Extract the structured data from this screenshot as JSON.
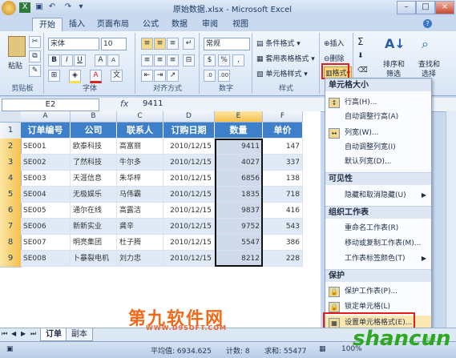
{
  "window": {
    "title": "原始数据.xlsx - Microsoft Excel"
  },
  "ribbon_tabs": [
    "开始",
    "插入",
    "页面布局",
    "公式",
    "数据",
    "审阅",
    "视图"
  ],
  "ribbon": {
    "clipboard": {
      "paste": "粘贴",
      "label": "剪贴板"
    },
    "font": {
      "name": "宋体",
      "size": "10",
      "label": "字体",
      "bold": "B",
      "italic": "I",
      "underline": "U",
      "grow": "A",
      "shrink": "A",
      "color": "A"
    },
    "alignment": {
      "label": "对齐方式"
    },
    "number": {
      "format": "常规",
      "label": "数字",
      "percent": "%",
      "comma": ",",
      "currency": "$"
    },
    "styles": {
      "conditional": "条件格式",
      "table": "套用表格格式",
      "cell": "单元格样式",
      "label": "样式"
    },
    "cells": {
      "insert": "插入",
      "delete": "删除",
      "format": "格式"
    },
    "editing": {
      "sum": "Σ",
      "sort": "排序和",
      "sort2": "筛选",
      "find": "查找和",
      "find2": "选择"
    }
  },
  "formula_bar": {
    "name_box": "E2",
    "fx": "fx",
    "value": "9411"
  },
  "columns": [
    "A",
    "B",
    "C",
    "D",
    "E",
    "F"
  ],
  "selected_column": "E",
  "rows": [
    "1",
    "2",
    "3",
    "4",
    "5",
    "6",
    "7",
    "8",
    "9"
  ],
  "table": {
    "headers": [
      "订单编号",
      "公司",
      "联系人",
      "订购日期",
      "数量",
      "单价"
    ],
    "data": [
      [
        "SE001",
        "欧泰科技",
        "高富丽",
        "2010/12/15",
        "9411",
        "147"
      ],
      [
        "SE002",
        "了然科技",
        "牛尔多",
        "2010/12/15",
        "4027",
        "337"
      ],
      [
        "SE003",
        "天涯信息",
        "朱华梓",
        "2010/12/15",
        "6856",
        "138"
      ],
      [
        "SE004",
        "无极娱乐",
        "马伟霸",
        "2010/12/15",
        "1835",
        "718"
      ],
      [
        "SE005",
        "通尔在线",
        "高露洁",
        "2010/12/15",
        "9837",
        "416"
      ],
      [
        "SE006",
        "新新实业",
        "龚辛",
        "2010/12/15",
        "9752",
        "543"
      ],
      [
        "SE007",
        "明亮集团",
        "杜子腾",
        "2010/12/15",
        "5547",
        "386"
      ],
      [
        "SE008",
        "卜暴裂电机",
        "刘力忠",
        "2010/12/15",
        "8212",
        "228"
      ]
    ]
  },
  "sheet_tabs": [
    "订单",
    "副本"
  ],
  "status": {
    "average": "平均值: 6934.625",
    "count": "计数: 8",
    "sum": "求和: 55477",
    "zoom": "100%"
  },
  "menu": {
    "sections": {
      "cell_size": "单元格大小",
      "visibility": "可见性",
      "organize": "组织工作表",
      "protect": "保护"
    },
    "items": {
      "row_height": "行高(H)...",
      "autofit_row": "自动调整行高(A)",
      "col_width": "列宽(W)...",
      "autofit_col": "自动调整列宽(I)",
      "default_width": "默认列宽(D)...",
      "hide_unhide": "隐藏和取消隐藏(U)",
      "rename": "重命名工作表(R)",
      "move_copy": "移动或复制工作表(M)...",
      "tab_color": "工作表标签颜色(T)",
      "protect_sheet": "保护工作表(P)...",
      "lock_cell": "锁定单元格(L)",
      "format_cells": "设置单元格格式(E)..."
    }
  },
  "watermarks": {
    "site1": "第九软件网",
    "site1_url": "WWW.D9SOFT.COM",
    "site2": "shancun",
    "site2_sub": "山村"
  },
  "colors": {
    "header_blue": "#3d7fc9",
    "highlight_red": "#e0201b",
    "zebra": "#dfeaf6"
  }
}
